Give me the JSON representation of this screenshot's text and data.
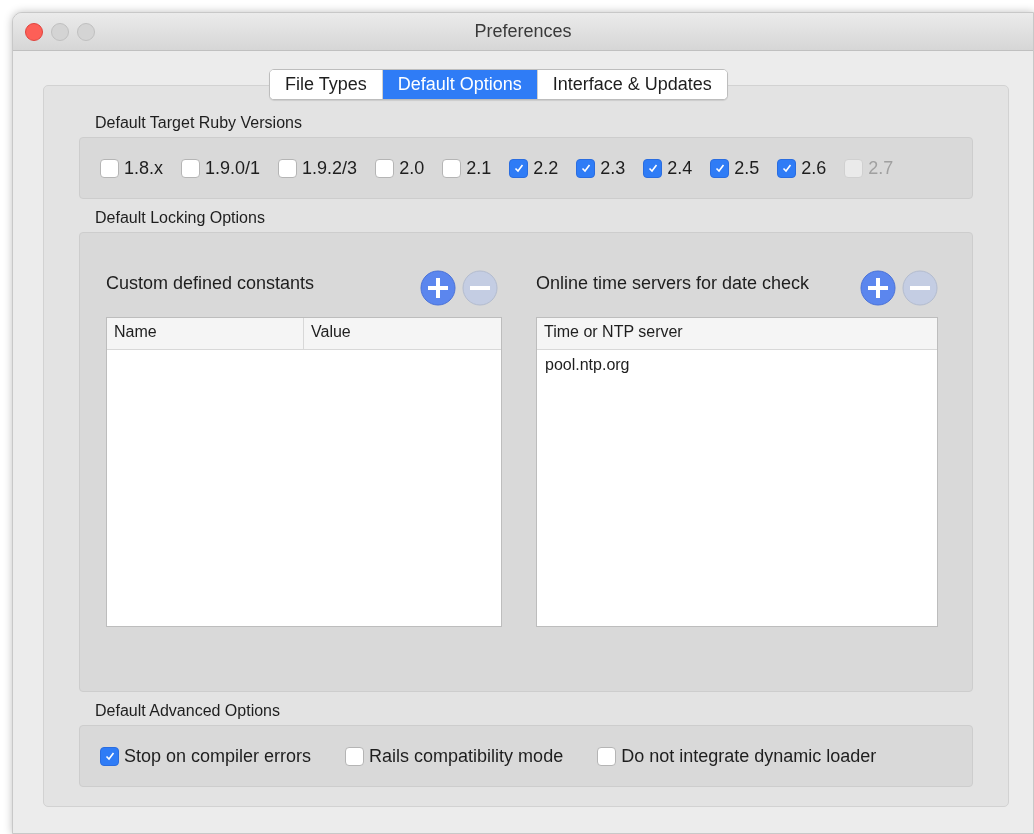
{
  "window": {
    "title": "Preferences"
  },
  "tabs": [
    {
      "label": "File Types",
      "selected": false
    },
    {
      "label": "Default Options",
      "selected": true
    },
    {
      "label": "Interface & Updates",
      "selected": false
    }
  ],
  "ruby_versions": {
    "title": "Default Target Ruby Versions",
    "options": [
      {
        "label": "1.8.x",
        "checked": false,
        "disabled": false
      },
      {
        "label": "1.9.0/1",
        "checked": false,
        "disabled": false
      },
      {
        "label": "1.9.2/3",
        "checked": false,
        "disabled": false
      },
      {
        "label": "2.0",
        "checked": false,
        "disabled": false
      },
      {
        "label": "2.1",
        "checked": false,
        "disabled": false
      },
      {
        "label": "2.2",
        "checked": true,
        "disabled": false
      },
      {
        "label": "2.3",
        "checked": true,
        "disabled": false
      },
      {
        "label": "2.4",
        "checked": true,
        "disabled": false
      },
      {
        "label": "2.5",
        "checked": true,
        "disabled": false
      },
      {
        "label": "2.6",
        "checked": true,
        "disabled": false
      },
      {
        "label": "2.7",
        "checked": false,
        "disabled": true
      }
    ]
  },
  "locking": {
    "title": "Default Locking Options",
    "lists": [
      {
        "title": "Custom defined constants",
        "buttons": [
          {
            "kind": "add",
            "disabled": false
          },
          {
            "kind": "remove",
            "disabled": true
          }
        ],
        "columns": [
          "Name",
          "Value"
        ]
      },
      {
        "title": "Online time servers for date check",
        "buttons": [
          {
            "kind": "add",
            "disabled": false
          },
          {
            "kind": "remove",
            "disabled": true
          }
        ],
        "columns": [
          "Time or NTP server"
        ],
        "rows": [
          [
            "pool.ntp.org"
          ]
        ]
      }
    ]
  },
  "advanced": {
    "title": "Default Advanced Options",
    "options": [
      {
        "label": "Stop on compiler errors",
        "checked": true
      },
      {
        "label": "Rails compatibility mode",
        "checked": false
      },
      {
        "label": "Do not integrate dynamic loader",
        "checked": false
      }
    ]
  }
}
